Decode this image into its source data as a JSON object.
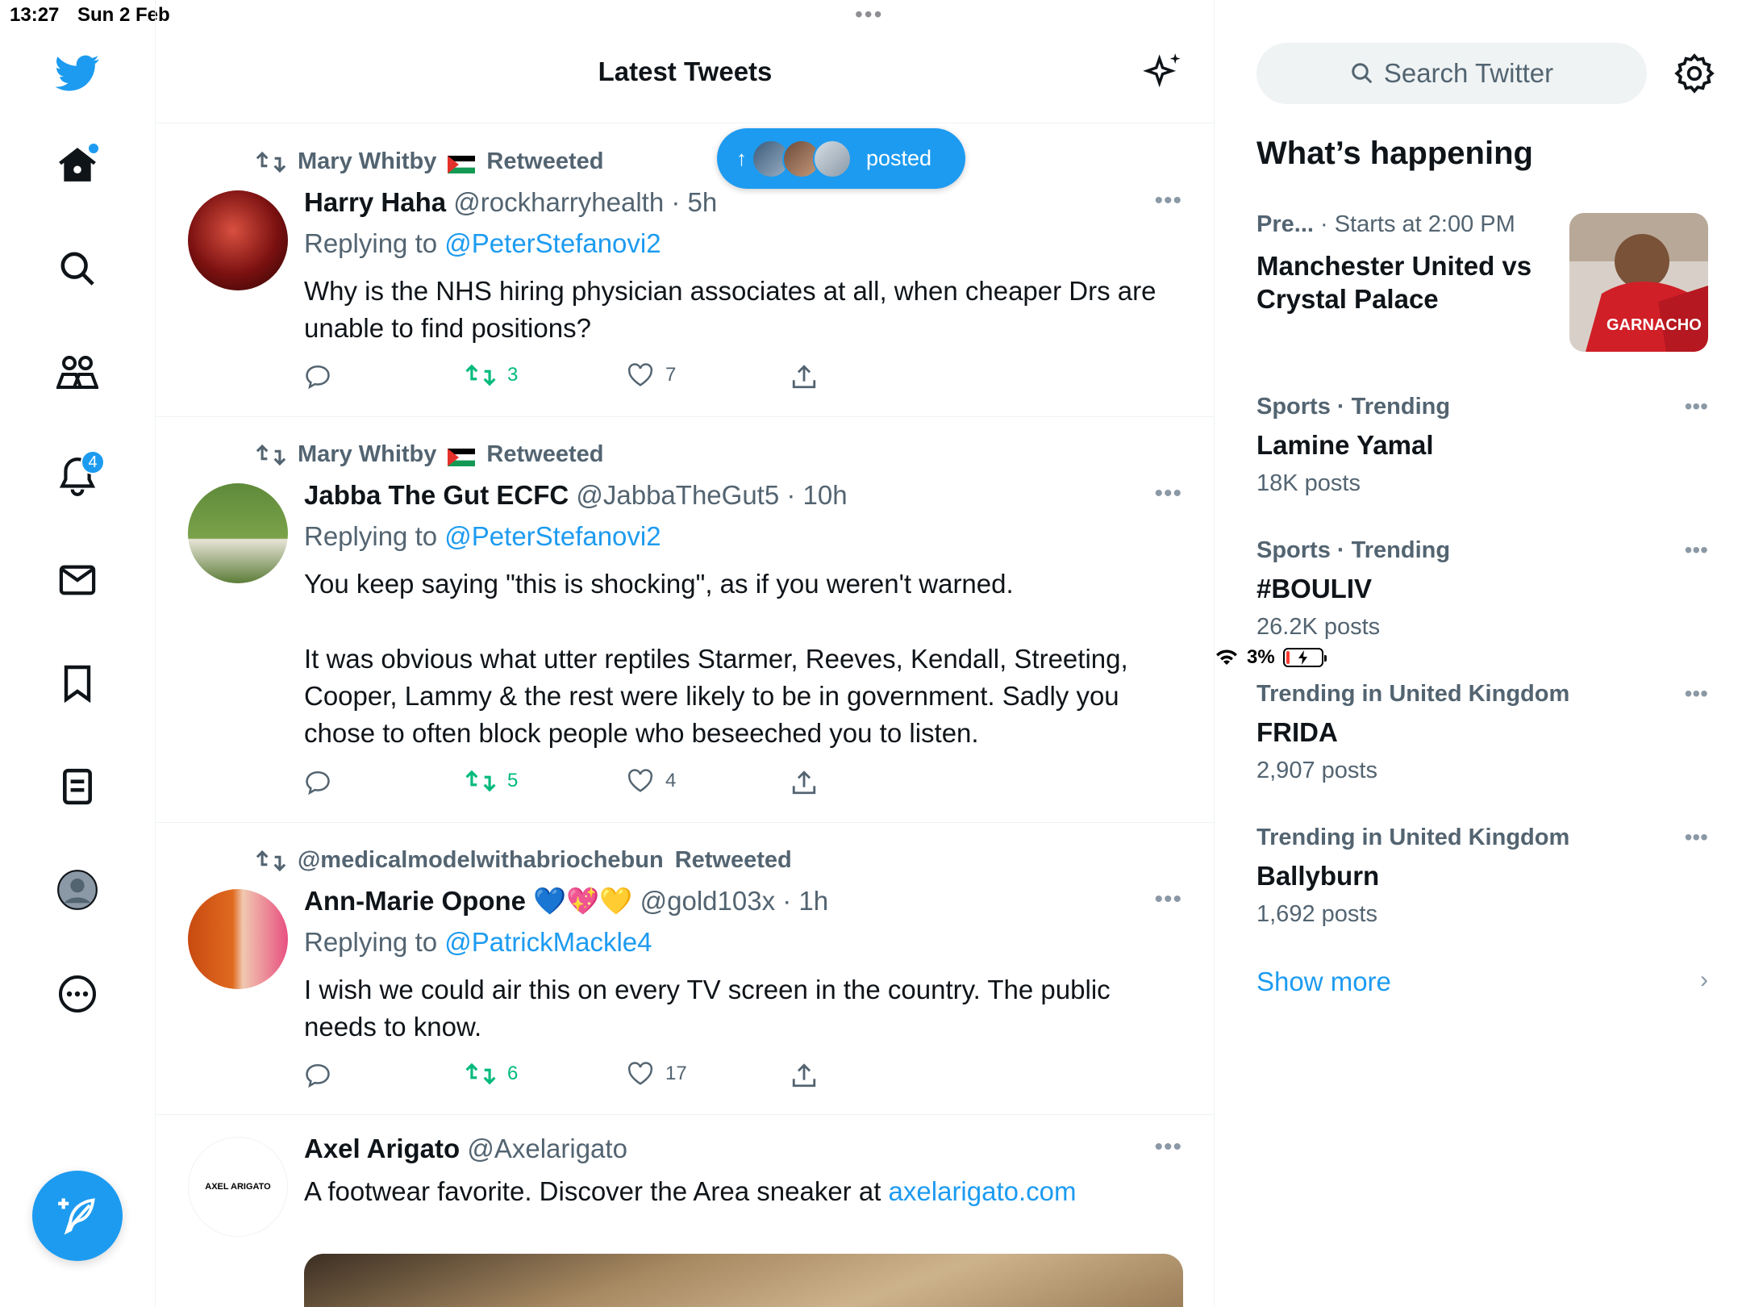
{
  "status_bar": {
    "time": "13:27",
    "date": "Sun 2 Feb",
    "battery": "3%"
  },
  "nav": {
    "notifications_badge": "4"
  },
  "header": {
    "title": "Latest Tweets"
  },
  "new_posts_pill": {
    "label": "posted"
  },
  "tweets": [
    {
      "retweeted_by": "Mary Whitby",
      "retweeted_label": "Retweeted",
      "name": "Harry Haha",
      "handle": "@rockharryhealth",
      "time": "5h",
      "replying_prefix": "Replying to",
      "replying_to": "@PeterStefanovi2",
      "body": "Why is the NHS hiring physician associates at all, when cheaper Drs are unable to find positions?",
      "retweets": "3",
      "likes": "7"
    },
    {
      "retweeted_by": "Mary Whitby",
      "retweeted_label": "Retweeted",
      "name": "Jabba The Gut ECFC",
      "handle": "@JabbaTheGut5",
      "time": "10h",
      "replying_prefix": "Replying to",
      "replying_to": "@PeterStefanovi2",
      "body_p1": "You keep saying \"this is shocking\", as if you weren't warned.",
      "body_p2": "It was obvious what utter reptiles Starmer, Reeves, Kendall, Streeting, Cooper, Lammy & the rest were likely to be in government. Sadly you chose to often block people who beseeched you to listen.",
      "retweets": "5",
      "likes": "4"
    },
    {
      "retweeted_by": "@medicalmodelwithabriochebun",
      "retweeted_label": "Retweeted",
      "name": "Ann-Marie Opone",
      "emojis": "💙💖💛",
      "handle": "@gold103x",
      "time": "1h",
      "replying_prefix": "Replying to",
      "replying_to": "@PatrickMackle4",
      "body": "I wish we could air this on every TV screen in the country. The public needs to know.",
      "retweets": "6",
      "likes": "17"
    },
    {
      "name": "Axel Arigato",
      "handle": "@Axelarigato",
      "avatar_text": "AXEL ARIGATO",
      "body": "A footwear favorite. Discover the Area  sneaker at",
      "link": "axelarigato.com"
    }
  ],
  "search": {
    "placeholder": "Search Twitter"
  },
  "whats_happening": {
    "title": "What’s happening",
    "event": {
      "category": "Pre...",
      "time": "· Starts at 2:00 PM",
      "title": "Manchester United vs Crystal Palace",
      "thumb_text": "GARNACHO"
    },
    "trends": [
      {
        "category": "Sports · Trending",
        "name": "Lamine Yamal",
        "posts": "18K posts"
      },
      {
        "category": "Sports · Trending",
        "name": "#BOULIV",
        "posts": "26.2K posts"
      },
      {
        "category": "Trending in United Kingdom",
        "name": "FRIDA",
        "posts": "2,907 posts"
      },
      {
        "category": "Trending in United Kingdom",
        "name": "Ballyburn",
        "posts": "1,692 posts"
      }
    ],
    "show_more": "Show more"
  },
  "colors": {
    "accent": "#1d9bf0",
    "retweet_green": "#00ba7c",
    "secondary_text": "#536471"
  }
}
